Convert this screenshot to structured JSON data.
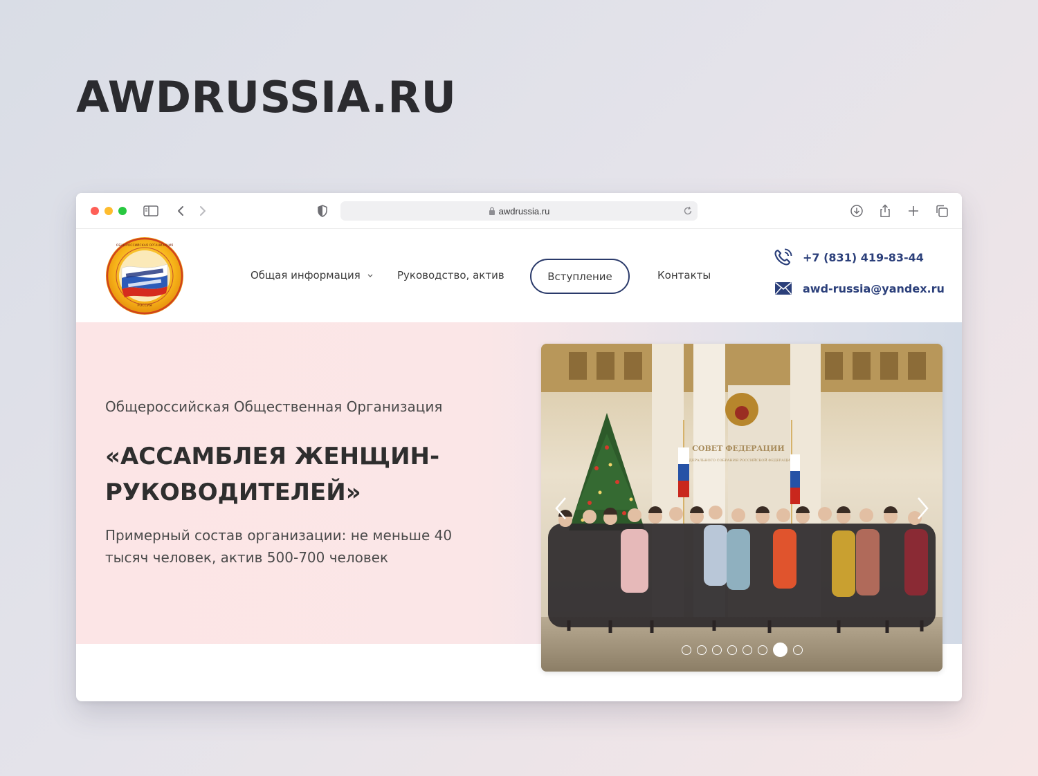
{
  "page": {
    "heading": "AWDRUSSIA.RU"
  },
  "browser": {
    "url": "awdrussia.ru",
    "icons": [
      "sidebar-icon",
      "back-icon",
      "forward-icon",
      "shield-icon",
      "lock-icon",
      "reload-icon",
      "download-icon",
      "share-icon",
      "new-tab-icon",
      "tabs-overview-icon"
    ]
  },
  "header": {
    "logo_alt": "Общероссийская общественная организация «Ассамблея женщин-руководителей» Россия",
    "nav": {
      "general_info": "Общая информация",
      "leadership": "Руководство, актив",
      "join": "Вступление",
      "contacts": "Контакты"
    },
    "phone": "+7 (831) 419-83-44",
    "email": "awd-russia@yandex.ru",
    "accent_color": "#2b3f7a"
  },
  "hero": {
    "subtitle": "Общероссийская Общественная Организация",
    "title": "«АССАМБЛЕЯ ЖЕНЩИН-РУКОВОДИТЕЛЕЙ»",
    "description": "Примерный состав организации: не меньше 40 тысяч человек, актив 500-700 человек"
  },
  "slider": {
    "slide_count": 8,
    "active_slide": 7,
    "photo_sign": "СОВЕТ ФЕДЕРАЦИИ",
    "photo_sign_sub": "ФЕДЕРАЛЬНОГО СОБРАНИЯ РОССИЙСКОЙ ФЕДЕРАЦИИ"
  }
}
